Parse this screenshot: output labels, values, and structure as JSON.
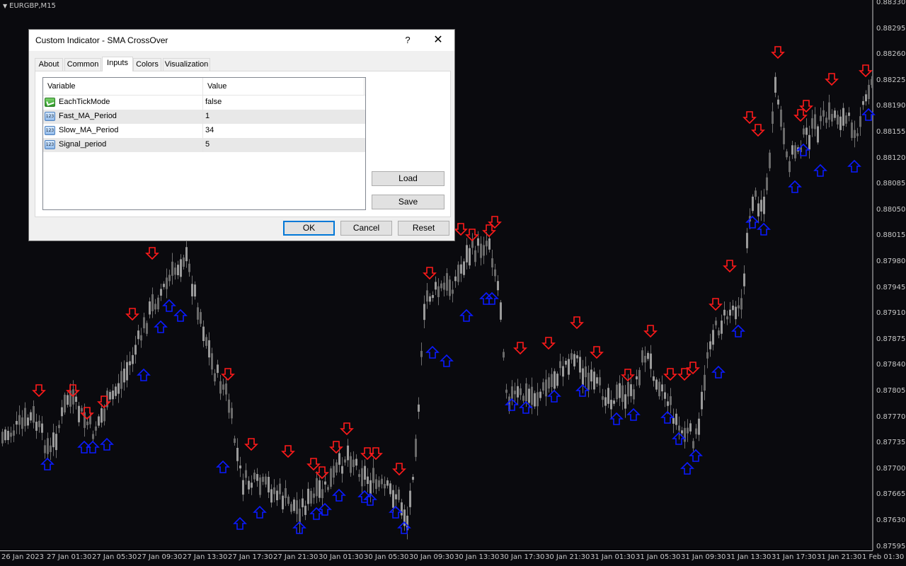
{
  "chart": {
    "symbol": "EURGBP,M15",
    "background": "#0a0a0e",
    "candle_color": "#8c8c8c",
    "buy_arrow_color": "#0a1aff",
    "sell_arrow_color": "#ff1a1a",
    "price_labels": [
      "0.88330",
      "0.88295",
      "0.88260",
      "0.88225",
      "0.88190",
      "0.88155",
      "0.88120",
      "0.88085",
      "0.88050",
      "0.88015",
      "0.87980",
      "0.87945",
      "0.87910",
      "0.87875",
      "0.87840",
      "0.87805",
      "0.87770",
      "0.87735",
      "0.87700",
      "0.87665",
      "0.87630",
      "0.87595"
    ],
    "time_labels": [
      "26 Jan 2023",
      "27 Jan 01:30",
      "27 Jan 05:30",
      "27 Jan 09:30",
      "27 Jan 13:30",
      "27 Jan 17:30",
      "27 Jan 21:30",
      "30 Jan 01:30",
      "30 Jan 05:30",
      "30 Jan 09:30",
      "30 Jan 13:30",
      "30 Jan 17:30",
      "30 Jan 21:30",
      "31 Jan 01:30",
      "31 Jan 05:30",
      "31 Jan 09:30",
      "31 Jan 13:30",
      "31 Jan 17:30",
      "31 Jan 21:30",
      "1 Feb 01:30"
    ]
  },
  "dialog": {
    "title": "Custom Indicator - SMA CrossOver",
    "help": "?",
    "close": "✕",
    "tabs": [
      "About",
      "Common",
      "Inputs",
      "Colors",
      "Visualization"
    ],
    "active_tab": "Inputs",
    "columns": {
      "variable": "Variable",
      "value": "Value"
    },
    "inputs": [
      {
        "icon": "bool-icon",
        "variable": "EachTickMode",
        "value": "false"
      },
      {
        "icon": "number-icon",
        "icon_text": "123",
        "variable": "Fast_MA_Period",
        "value": "1"
      },
      {
        "icon": "number-icon",
        "icon_text": "123",
        "variable": "Slow_MA_Period",
        "value": "34"
      },
      {
        "icon": "number-icon",
        "icon_text": "123",
        "variable": "Signal_period",
        "value": "5"
      }
    ],
    "buttons": {
      "load": "Load",
      "save": "Save",
      "ok": "OK",
      "cancel": "Cancel",
      "reset": "Reset"
    }
  }
}
